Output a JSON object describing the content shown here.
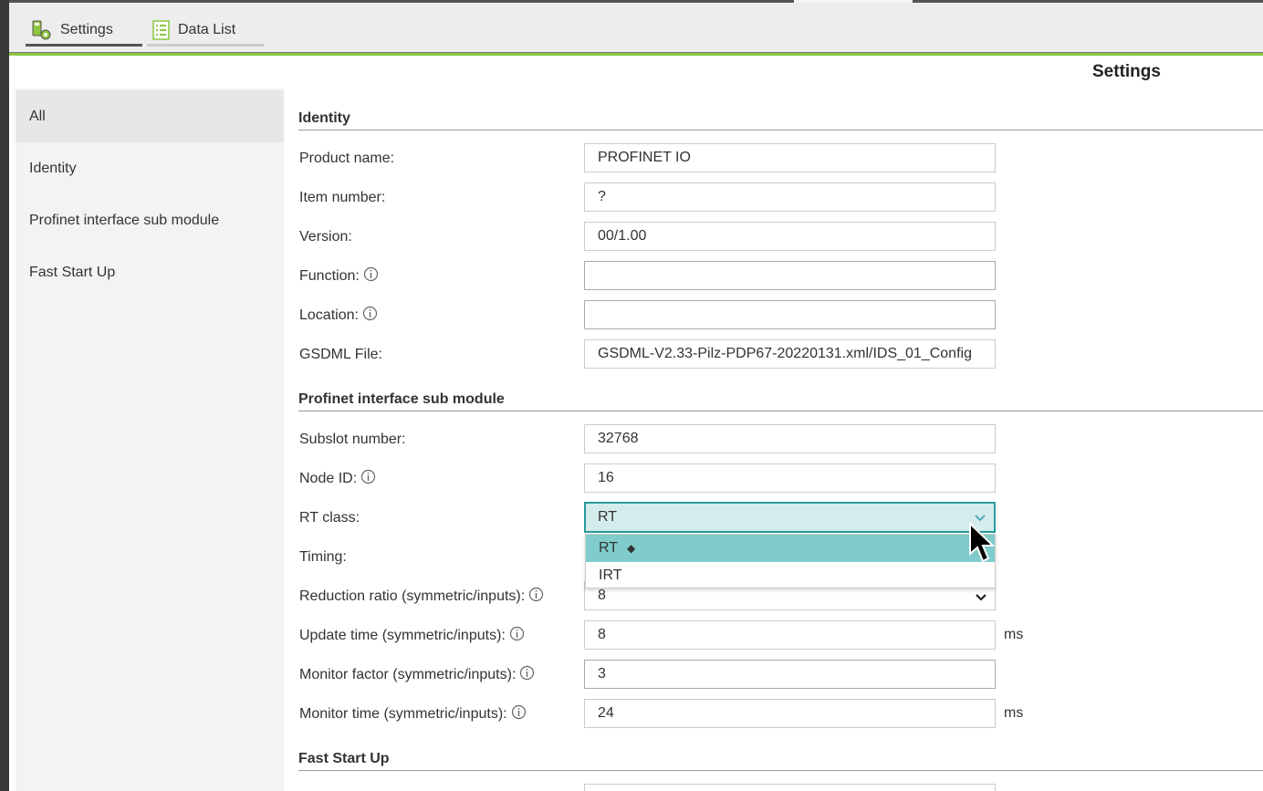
{
  "tabs": [
    {
      "label": "Settings",
      "icon": "settings-gear-icon"
    },
    {
      "label": "Data List",
      "icon": "list-icon"
    }
  ],
  "page_title": "Settings",
  "sidebar": {
    "items": [
      {
        "label": "All",
        "active": true
      },
      {
        "label": "Identity"
      },
      {
        "label": "Profinet interface sub module"
      },
      {
        "label": "Fast Start Up"
      }
    ]
  },
  "identity": {
    "heading": "Identity",
    "product_name": {
      "label": "Product name:",
      "value": "PROFINET IO"
    },
    "item_number": {
      "label": "Item number:",
      "value": "?"
    },
    "version": {
      "label": "Version:",
      "value": "00/1.00"
    },
    "function": {
      "label": "Function:",
      "value": ""
    },
    "location": {
      "label": "Location:",
      "value": ""
    },
    "gsdml": {
      "label": "GSDML File:",
      "value": "GSDML-V2.33-Pilz-PDP67-20220131.xml/IDS_01_Config"
    }
  },
  "profinet": {
    "heading": "Profinet interface sub module",
    "subslot": {
      "label": "Subslot number:",
      "value": "32768"
    },
    "node_id": {
      "label": "Node ID:",
      "value": "16"
    },
    "rt_class": {
      "label": "RT class:",
      "value": "RT",
      "options": [
        "RT",
        "IRT"
      ],
      "selected_mark": "◆"
    },
    "timing": {
      "label": "Timing:"
    },
    "reduction": {
      "label": "Reduction ratio (symmetric/inputs):",
      "value": "8"
    },
    "update": {
      "label": "Update time (symmetric/inputs):",
      "value": "8",
      "unit": "ms"
    },
    "monitor_factor": {
      "label": "Monitor factor (symmetric/inputs):",
      "value": "3"
    },
    "monitor_time": {
      "label": "Monitor time (symmetric/inputs):",
      "value": "24",
      "unit": "ms"
    }
  },
  "fast_start": {
    "heading": "Fast Start Up"
  },
  "colors": {
    "accent_green": "#8cc63f",
    "select_teal": "#2a9a9a",
    "option_highlight": "#80cccc"
  }
}
